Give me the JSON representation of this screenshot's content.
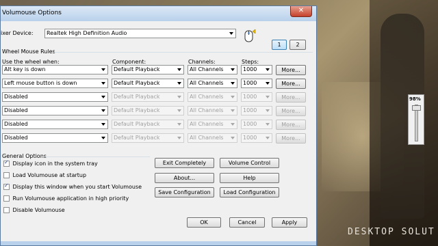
{
  "window": {
    "title": "Volumouse Options",
    "close_glyph": "✕"
  },
  "mixer": {
    "label": "ixer Device:",
    "device": "Realtek High Definition Audio",
    "page_buttons": [
      "1",
      "2"
    ]
  },
  "rules": {
    "group_title": "Wheel Mouse Rules",
    "headers": {
      "when": "Use the wheel when:",
      "component": "Component:",
      "channels": "Channels:",
      "steps": "Steps:"
    },
    "rows": [
      {
        "when": "Alt key is down",
        "component": "Default Playback",
        "channels": "All Channels",
        "steps": "1000",
        "more": "More...",
        "enabled": true
      },
      {
        "when": "Left mouse button is down",
        "component": "Default Playback",
        "channels": "All Channels",
        "steps": "1000",
        "more": "More...",
        "enabled": true
      },
      {
        "when": "Disabled",
        "component": "Default Playback",
        "channels": "All Channels",
        "steps": "1000",
        "more": "More...",
        "enabled": false
      },
      {
        "when": "Disabled",
        "component": "Default Playback",
        "channels": "All Channels",
        "steps": "1000",
        "more": "More...",
        "enabled": false
      },
      {
        "when": "Disabled",
        "component": "Default Playback",
        "channels": "All Channels",
        "steps": "1000",
        "more": "More...",
        "enabled": false
      },
      {
        "when": "Disabled",
        "component": "Default Playback",
        "channels": "All Channels",
        "steps": "1000",
        "more": "More...",
        "enabled": false
      }
    ]
  },
  "general": {
    "title": "General Options",
    "options": [
      {
        "label": "Display icon in the system tray",
        "checked": true
      },
      {
        "label": "Load Volumouse at startup",
        "checked": false
      },
      {
        "label": "Display this window when you start Volumouse",
        "checked": true
      },
      {
        "label": "Run Volumouse application in high priority",
        "checked": false
      },
      {
        "label": "Disable Volumouse",
        "checked": false
      }
    ]
  },
  "actions": {
    "exit": "Exit Completely",
    "volume_control": "Volume Control",
    "about": "About...",
    "help": "Help",
    "save": "Save Configuration",
    "load": "Load Configuration"
  },
  "footer": {
    "ok": "OK",
    "cancel": "Cancel",
    "apply": "Apply"
  },
  "desktop": {
    "text": "DESKTOP SOLUT"
  },
  "volume_widget": {
    "percent": "98%",
    "level": 0.98
  }
}
